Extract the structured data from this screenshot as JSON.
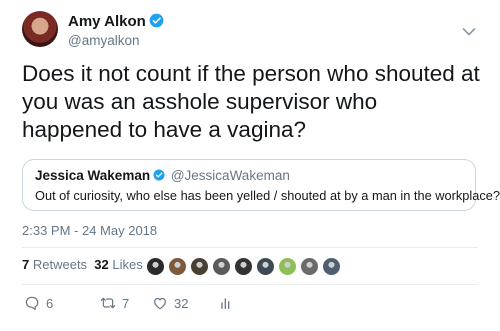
{
  "author": {
    "name": "Amy Alkon",
    "handle": "@amyalkon"
  },
  "tweet": {
    "text": "Does it not count if the person who shouted at you was an asshole supervisor who happened to have a vagina?",
    "timestamp": "2:33 PM - 24 May 2018"
  },
  "quoted": {
    "name": "Jessica Wakeman",
    "handle": "@JessicaWakeman",
    "text": "Out of curiosity, who else has been yelled / shouted at by a man in the workplace?"
  },
  "stats": {
    "retweets_count": "7",
    "retweets_label": "Retweets",
    "likes_count": "32",
    "likes_label": "Likes"
  },
  "likers": [
    {
      "color": "#2b2b2b"
    },
    {
      "color": "#7d5a3c"
    },
    {
      "color": "#4a3f35"
    },
    {
      "color": "#5b5b5b"
    },
    {
      "color": "#333333"
    },
    {
      "color": "#3e4a55"
    },
    {
      "color": "#8fbf5a"
    },
    {
      "color": "#6b6b6b"
    },
    {
      "color": "#4f5f6f"
    }
  ],
  "actions": {
    "reply_count": "6",
    "retweet_count": "7",
    "like_count": "32"
  },
  "icons": {
    "verified": "verified-badge-icon",
    "chevron": "chevron-down-icon",
    "reply": "reply-icon",
    "retweet": "retweet-icon",
    "like": "heart-icon",
    "analytics": "analytics-icon"
  },
  "colors": {
    "verified": "#1da1f2",
    "secondary_text": "#657786",
    "border": "#ccd6dd"
  }
}
